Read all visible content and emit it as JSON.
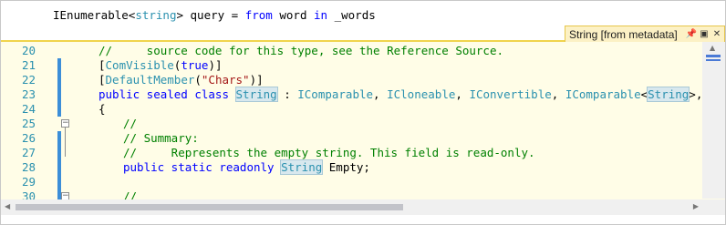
{
  "editor": {
    "top_code": {
      "prefix": "IEnumerable<",
      "type": "string",
      "suffix": "> query = ",
      "kw_from": "from",
      "word": " word ",
      "kw_in": "in",
      "rest": " _words"
    }
  },
  "peek": {
    "title": "String [from metadata]",
    "pin_icon": "pin-icon",
    "expand_icon": "promote-icon",
    "close_icon": "close-icon",
    "lines": [
      {
        "n": "20",
        "t": "//     source code for this type, see the Reference Source."
      },
      {
        "n": "21",
        "t": "[ComVisible(true)]"
      },
      {
        "n": "22",
        "t": "[DefaultMember(\"Chars\")]"
      },
      {
        "n": "23",
        "t": "public sealed class String : IComparable, ICloneable, IConvertible, IComparable<String>, IEnumer"
      },
      {
        "n": "24",
        "t": "{"
      },
      {
        "n": "25",
        "t": "//"
      },
      {
        "n": "26",
        "t": "// Summary:"
      },
      {
        "n": "27",
        "t": "//     Represents the empty string. This field is read-only."
      },
      {
        "n": "28",
        "t": "public static readonly String Empty;"
      },
      {
        "n": "29",
        "t": ""
      },
      {
        "n": "30",
        "t": "//"
      }
    ]
  },
  "colors": {
    "peek_border": "#f0d44d",
    "peek_bg": "#fffde7",
    "change_bar": "#3c8ed8"
  }
}
